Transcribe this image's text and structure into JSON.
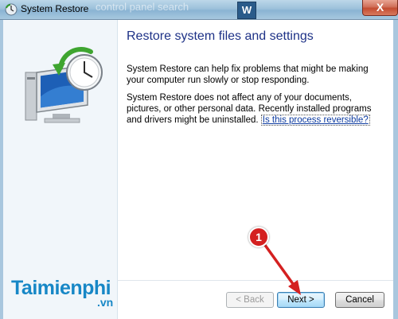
{
  "window": {
    "title": "System Restore",
    "background_title_ghost": "control panel search",
    "close_label": "X",
    "thumb_label": "W"
  },
  "content": {
    "heading": "Restore system files and settings",
    "paragraph1": "System Restore can help fix problems that might be making your computer run slowly or stop responding.",
    "paragraph2_text": "System Restore does not affect any of your documents, pictures, or other personal data. Recently installed programs and drivers might be uninstalled.",
    "paragraph2_link": "Is this process reversible?"
  },
  "buttons": {
    "back_label": "< Back",
    "next_label": "Next >",
    "cancel_label": "Cancel"
  },
  "watermark": {
    "name": "Taimienphi",
    "tld": ".vn"
  },
  "annotation": {
    "step_number": "1",
    "color": "#d42020"
  },
  "icons": {
    "title": "system-restore-icon",
    "hero": "monitor-restore-clock-icon"
  }
}
